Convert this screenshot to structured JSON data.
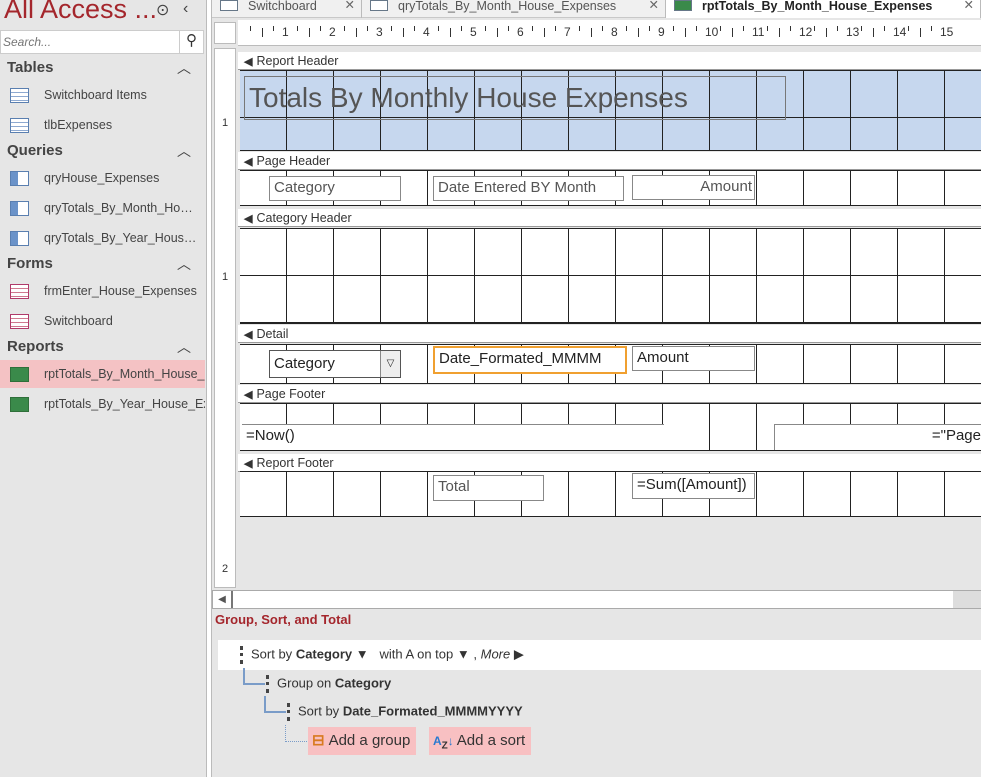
{
  "nav": {
    "title": "All Access ...",
    "search_placeholder": "Search...",
    "groups": [
      {
        "label": "Tables",
        "items": [
          "Switchboard Items",
          "tlbExpenses"
        ]
      },
      {
        "label": "Queries",
        "items": [
          "qryHouse_Expenses",
          "qryTotals_By_Month_House_Expenses",
          "qryTotals_By_Year_House_Expenses"
        ]
      },
      {
        "label": "Forms",
        "items": [
          "frmEnter_House_Expenses",
          "Switchboard"
        ]
      },
      {
        "label": "Reports",
        "items": [
          "rptTotals_By_Month_House_Expenses",
          "rptTotals_By_Year_House_Expenses"
        ]
      }
    ]
  },
  "tabs": [
    "Switchboard",
    "qryTotals_By_Month_House_Expenses",
    "rptTotals_By_Month_House_Expenses"
  ],
  "ruler": [
    "1",
    "2",
    "3",
    "4",
    "5",
    "6",
    "7",
    "8",
    "9",
    "10",
    "11",
    "12",
    "13",
    "14",
    "15"
  ],
  "vruler": [
    "1",
    "1",
    "2"
  ],
  "sections": {
    "report_header": "Report Header",
    "page_header": "Page Header",
    "category_header": "Category Header",
    "detail": "Detail",
    "page_footer": "Page Footer",
    "report_footer": "Report Footer"
  },
  "controls": {
    "title": "Totals By Monthly House Expenses",
    "ph_category": "Category",
    "ph_date": "Date Entered BY Month",
    "ph_amount": "Amount",
    "d_category": "Category",
    "d_date": "Date_Formated_MMMM",
    "d_amount": "Amount",
    "pf_now": "=Now()",
    "pf_page": "=\"Page",
    "rf_total": "Total",
    "rf_sum": "=Sum([Amount])"
  },
  "gst": {
    "title": "Group, Sort, and Total",
    "sort1": {
      "prefix": "Sort by",
      "field": "Category",
      "order": "with A on top",
      "sep": ",",
      "more": "More"
    },
    "group1": {
      "prefix": "Group on",
      "field": "Category"
    },
    "sort2": {
      "prefix": "Sort by",
      "field": "Date_Formated_MMMMYYYY"
    },
    "add_group": "Add a group",
    "add_sort": "Add a sort"
  }
}
